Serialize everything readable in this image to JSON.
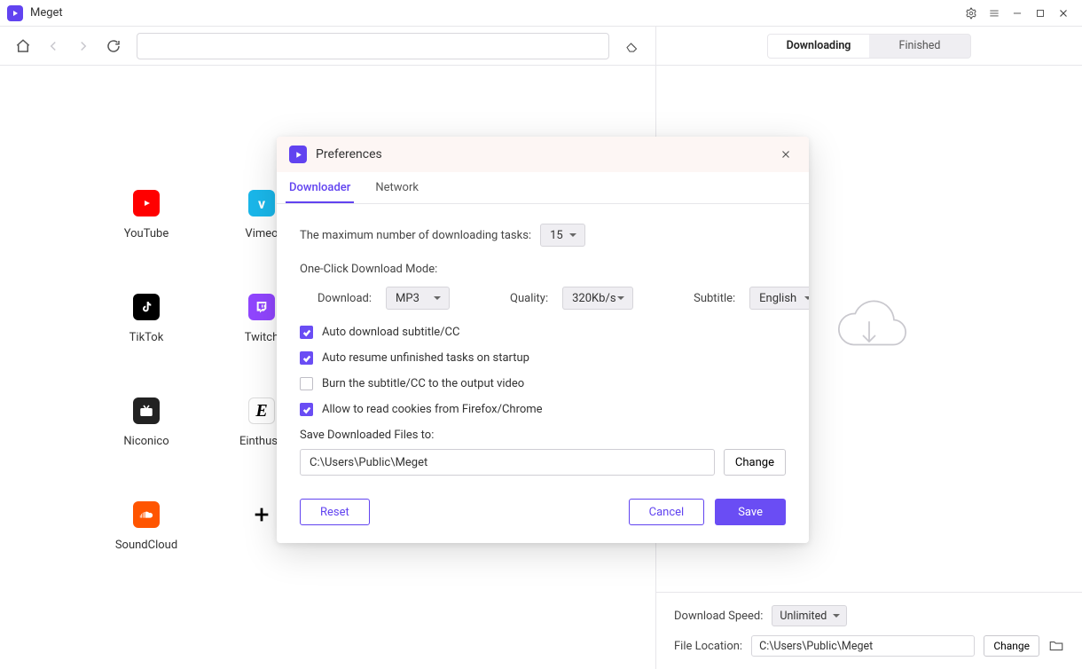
{
  "app": {
    "name": "Meget"
  },
  "rightPanel": {
    "tabs": {
      "downloading": "Downloading",
      "finished": "Finished"
    },
    "speedLabel": "Download Speed:",
    "speedValue": "Unlimited",
    "locationLabel": "File Location:",
    "locationValue": "C:\\Users\\Public\\Meget",
    "changeLabel": "Change"
  },
  "sites": {
    "youtube": "YouTube",
    "vimeo": "Vimeo",
    "tiktok": "TikTok",
    "twitch": "Twitch",
    "niconico": "Niconico",
    "einthusan": "Einthusa",
    "soundcloud": "SoundCloud"
  },
  "prefs": {
    "title": "Preferences",
    "tabDownloader": "Downloader",
    "tabNetwork": "Network",
    "maxTasksLabel": "The maximum number of downloading tasks:",
    "maxTasksValue": "15",
    "oneClickLabel": "One-Click Download Mode:",
    "downloadLabel": "Download:",
    "downloadValue": "MP3",
    "qualityLabel": "Quality:",
    "qualityValue": "320Kb/s",
    "subtitleLabel": "Subtitle:",
    "subtitleValue": "English",
    "cbAutoSubtitle": "Auto download subtitle/CC",
    "cbAutoResume": "Auto resume unfinished tasks on startup",
    "cbBurn": "Burn the subtitle/CC to the output video",
    "cbCookies": "Allow to read cookies from Firefox/Chrome",
    "saveToLabel": "Save Downloaded Files to:",
    "saveToPath": "C:\\Users\\Public\\Meget",
    "changeLabel": "Change",
    "resetLabel": "Reset",
    "cancelLabel": "Cancel",
    "saveLabel": "Save"
  }
}
